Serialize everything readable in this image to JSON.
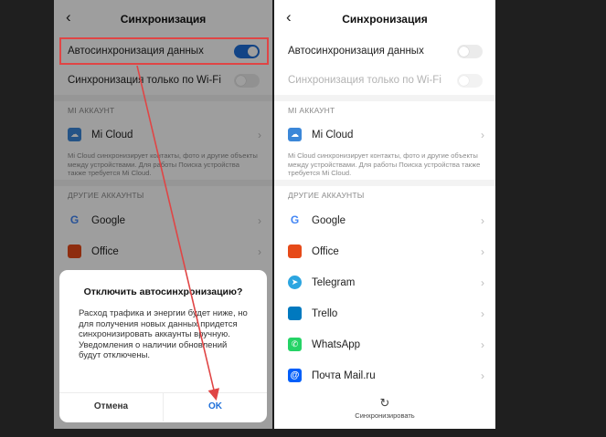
{
  "header": {
    "title": "Синхронизация",
    "back_icon": "back-arrow-icon"
  },
  "settings": {
    "auto_sync_label": "Автосинхронизация данных",
    "wifi_only_label": "Синхронизация только по Wi-Fi"
  },
  "mi_account": {
    "section": "MI АККАУНТ",
    "item": "Mi Cloud",
    "note": "Mi Cloud синхронизирует контакты, фото и другие объекты между устройствами. Для работы Поиска устройства также требуется Mi Cloud."
  },
  "other_accounts": {
    "section": "ДРУГИЕ АККАУНТЫ",
    "items": [
      "Google",
      "Office",
      "Telegram",
      "Trello",
      "WhatsApp",
      "Почта Mail.ru"
    ]
  },
  "dialog": {
    "title": "Отключить автосинхронизацию?",
    "body": "Расход трафика и энергии будет ниже, но для получения новых данных придется синхронизировать аккаунты вручную. Уведомления о наличии обновлений будут отключены.",
    "cancel": "Отмена",
    "ok": "OK"
  },
  "sync_button": {
    "label": "Синхронизировать",
    "icon": "refresh-icon"
  },
  "state": {
    "left_auto_sync": true,
    "left_wifi_only": false,
    "right_auto_sync": false,
    "right_wifi_only": false
  },
  "colors": {
    "accent": "#1e6fd9",
    "annotation": "#e04545",
    "google": "#4285f4",
    "office": "#e64a19",
    "telegram": "#2ca5e0",
    "trello": "#0079bf",
    "whatsapp": "#25d366",
    "mailru": "#005ff9",
    "mi_cloud": "#3b87d8"
  }
}
